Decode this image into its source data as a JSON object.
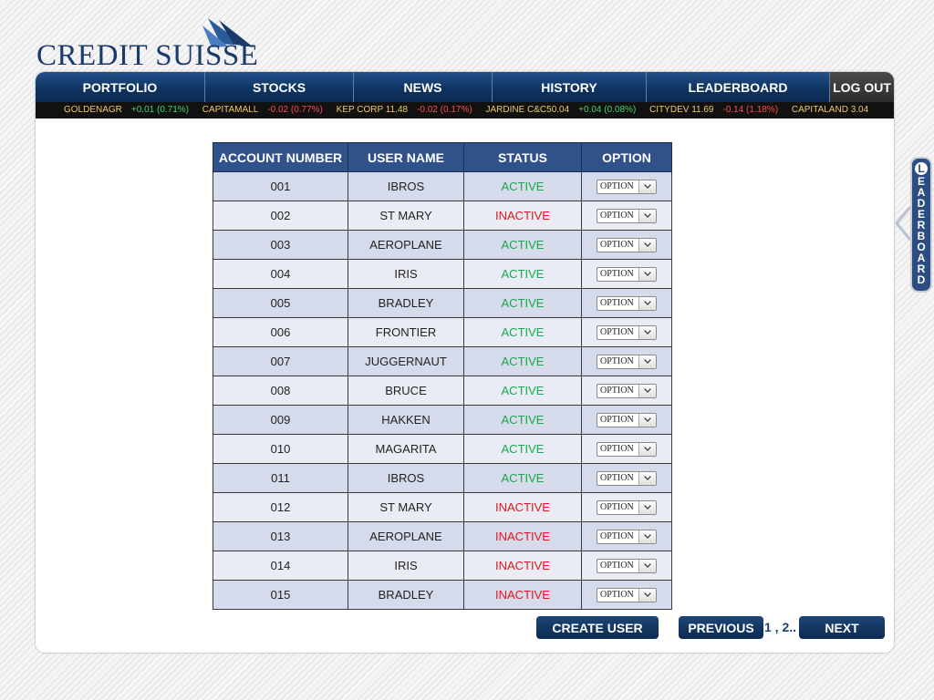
{
  "brand": {
    "name": "Credit Suisse",
    "logo_text": "CREDIT SUISSE",
    "color": "#1a3a6c"
  },
  "nav": {
    "items": [
      {
        "label": "PORTFOLIO"
      },
      {
        "label": "STOCKS"
      },
      {
        "label": "NEWS"
      },
      {
        "label": "HISTORY"
      },
      {
        "label": "LEADERBOARD"
      }
    ],
    "logout_label": "LOG OUT"
  },
  "ticker": [
    {
      "name": "GOLDENAGR",
      "price": "",
      "change": "+0.01 (0.71%)",
      "direction": "up"
    },
    {
      "name": "CAPITAMALL",
      "price": "",
      "change": "-0.02 (0.77%)",
      "direction": "down"
    },
    {
      "name": "KEP CORP",
      "price": "11.48",
      "change": "-0.02 (0.17%)",
      "direction": "down"
    },
    {
      "name": "JARDINE C&C",
      "price": "50.04",
      "change": "+0.04 (0.08%)",
      "direction": "up"
    },
    {
      "name": "CITYDEV",
      "price": "11.69",
      "change": "-0.14 (1.18%)",
      "direction": "down"
    },
    {
      "name": "CAPITALAND",
      "price": "3.04",
      "change": "",
      "direction": ""
    }
  ],
  "table": {
    "headers": [
      "ACCOUNT NUMBER",
      "USER NAME",
      "STATUS",
      "OPTION"
    ],
    "option_label": "OPTION",
    "rows": [
      {
        "account": "001",
        "user": "IBROS",
        "status": "ACTIVE"
      },
      {
        "account": "002",
        "user": "ST MARY",
        "status": "INACTIVE"
      },
      {
        "account": "003",
        "user": "AEROPLANE",
        "status": "ACTIVE"
      },
      {
        "account": "004",
        "user": "IRIS",
        "status": "ACTIVE"
      },
      {
        "account": "005",
        "user": "BRADLEY",
        "status": "ACTIVE"
      },
      {
        "account": "006",
        "user": "FRONTIER",
        "status": "ACTIVE"
      },
      {
        "account": "007",
        "user": "JUGGERNAUT",
        "status": "ACTIVE"
      },
      {
        "account": "008",
        "user": "BRUCE",
        "status": "ACTIVE"
      },
      {
        "account": "009",
        "user": "HAKKEN",
        "status": "ACTIVE"
      },
      {
        "account": "010",
        "user": "MAGARITA",
        "status": "ACTIVE"
      },
      {
        "account": "011",
        "user": "IBROS",
        "status": "ACTIVE"
      },
      {
        "account": "012",
        "user": "ST MARY",
        "status": "INACTIVE"
      },
      {
        "account": "013",
        "user": "AEROPLANE",
        "status": "INACTIVE"
      },
      {
        "account": "014",
        "user": "IRIS",
        "status": "INACTIVE"
      },
      {
        "account": "015",
        "user": "BRADLEY",
        "status": "INACTIVE"
      }
    ]
  },
  "actions": {
    "create_user": "CREATE USER",
    "previous": "PREVIOUS",
    "pages": "1 , 2..",
    "next": "NEXT"
  },
  "side_tab": {
    "label": "LEADERBOARD",
    "icon": "chevron-left-icon"
  },
  "colors": {
    "nav_bg": "#0f3461",
    "header_bg": "#31518a",
    "active": "#19a84c",
    "inactive": "#e5161c",
    "ticker_up": "#3fd66a",
    "ticker_down": "#ff4b4b",
    "ticker_name": "#f2c86b"
  }
}
